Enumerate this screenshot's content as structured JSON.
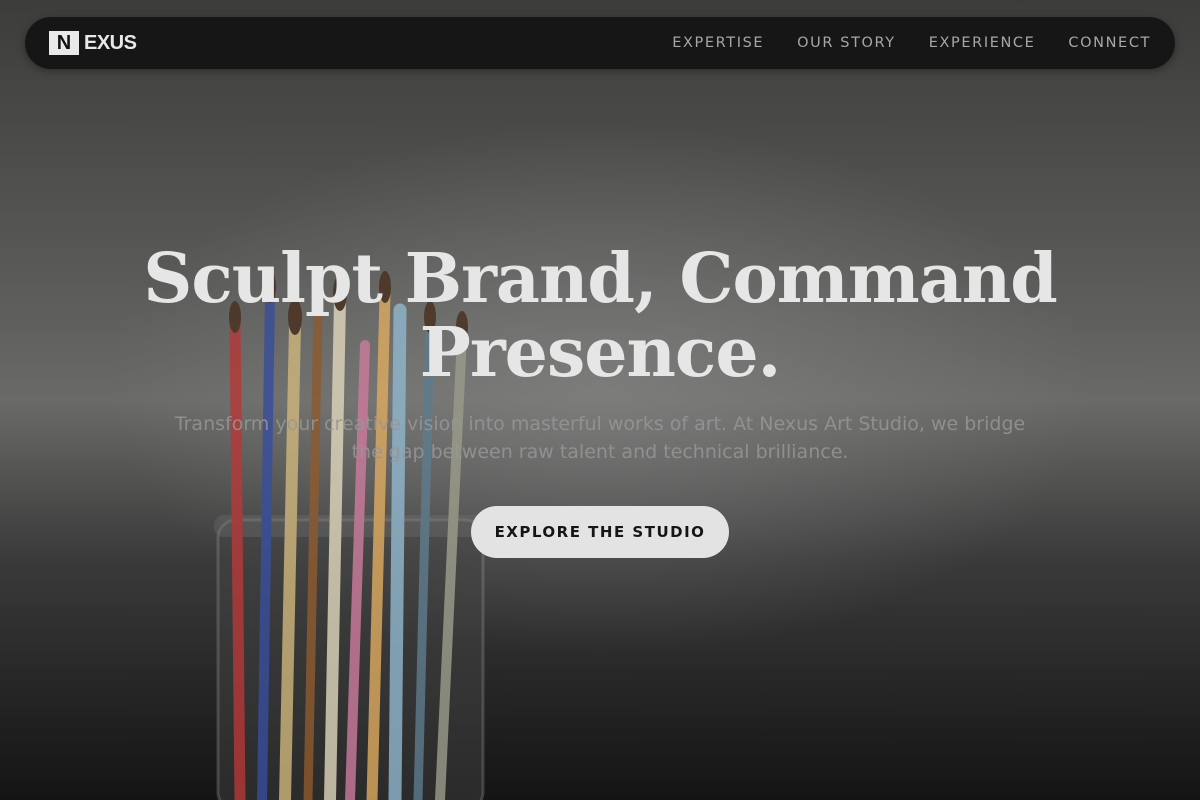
{
  "brand": {
    "logo_mark": "N",
    "logo_text": "EXUS"
  },
  "nav": {
    "items": [
      {
        "label": "EXPERTISE"
      },
      {
        "label": "OUR STORY"
      },
      {
        "label": "EXPERIENCE"
      },
      {
        "label": "CONNECT"
      }
    ]
  },
  "hero": {
    "title_line1": "Sculpt Brand, Command",
    "title_line2": "Presence.",
    "subtitle": "Transform your creative vision into masterful works of art. At Nexus Art Studio, we bridge the gap between raw talent and technical brilliance.",
    "cta_label": "EXPLORE THE STUDIO",
    "background_image": "paintbrushes-in-glass-jar"
  },
  "colors": {
    "nav_bg": "#161616",
    "text_light": "#e6e6e6",
    "cta_bg": "#e3e3e3"
  }
}
